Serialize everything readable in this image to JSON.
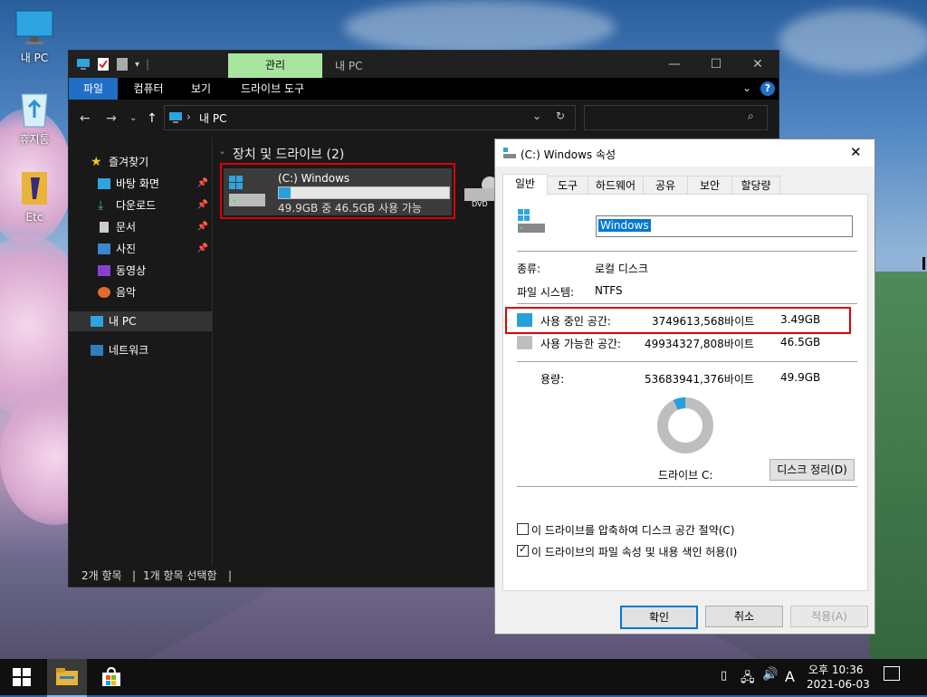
{
  "desktop": {
    "icons": [
      {
        "label": "내 PC",
        "icon": "monitor-icon"
      },
      {
        "label": "휴지통",
        "icon": "recycle-bin-icon"
      },
      {
        "label": "Etc",
        "icon": "folder-icon"
      }
    ]
  },
  "explorer": {
    "titlebar": {
      "contextual_tab": "관리",
      "window_title": "내 PC",
      "colors": {
        "contextual_tab_bg": "#a8e6a0"
      }
    },
    "ribbon_tabs": [
      "파일",
      "컴퓨터",
      "보기",
      "드라이브 도구"
    ],
    "address": {
      "path": "내 PC"
    },
    "search": {
      "placeholder": ""
    },
    "nav": {
      "quick_access": "즐겨찾기",
      "items": [
        {
          "label": "바탕 화면",
          "icon": "desktop-icon",
          "pinned": true
        },
        {
          "label": "다운로드",
          "icon": "download-icon",
          "pinned": true
        },
        {
          "label": "문서",
          "icon": "document-icon",
          "pinned": true
        },
        {
          "label": "사진",
          "icon": "pictures-icon",
          "pinned": true
        },
        {
          "label": "동영상",
          "icon": "videos-icon",
          "pinned": false
        },
        {
          "label": "음악",
          "icon": "music-icon",
          "pinned": false
        }
      ],
      "this_pc": "내 PC",
      "network": "네트워크"
    },
    "content": {
      "group_header": "장치 및 드라이브 (2)",
      "drive_c": {
        "name": "(C:) Windows",
        "space_text": "49.9GB 중 46.5GB 사용 가능",
        "used_fraction": 0.07
      },
      "dvd_label": "DVD"
    },
    "status": {
      "items": "2개 항목",
      "selected": "1개 항목 선택함"
    }
  },
  "dialog": {
    "title": "(C:) Windows 속성",
    "tabs": [
      "일반",
      "도구",
      "하드웨어",
      "공유",
      "보안",
      "할당량"
    ],
    "active_tab": "일반",
    "name_value": "Windows",
    "type_label": "종류:",
    "type_value": "로컬 디스크",
    "fs_label": "파일 시스템:",
    "fs_value": "NTFS",
    "used": {
      "label": "사용 중인 공간:",
      "bytes": "3749613,568바이트",
      "size": "3.49GB",
      "color": "#26a0da"
    },
    "free": {
      "label": "사용 가능한 공간:",
      "bytes": "49934327,808바이트",
      "size": "46.5GB",
      "color": "#bebebe"
    },
    "capacity": {
      "label": "용량:",
      "bytes": "53683941,376바이트",
      "size": "49.9GB"
    },
    "drive_label": "드라이브 C:",
    "cleanup_button": "디스크 정리(D)",
    "compress_label": "이 드라이브를 압축하여 디스크 공간 절약(C)",
    "compress_checked": false,
    "index_label": "이 드라이브의 파일 속성 및 내용 색인 허용(I)",
    "index_checked": true,
    "ok_button": "확인",
    "cancel_button": "취소",
    "apply_button": "적용(A)",
    "used_fraction": 0.07
  },
  "taskbar": {
    "time": "오후 10:36",
    "date": "2021-06-03",
    "ime": "A"
  }
}
